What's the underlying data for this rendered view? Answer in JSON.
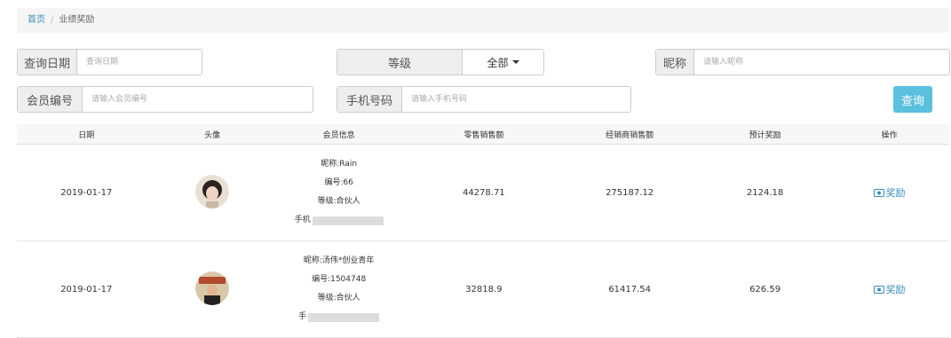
{
  "breadcrumb": {
    "home": "首页",
    "separator": "/",
    "current": "业绩奖励"
  },
  "filters": {
    "date_label": "查询日期",
    "date_placeholder": "查询日期",
    "level_label": "等级",
    "level_value": "全部",
    "nickname_label": "昵称",
    "nickname_placeholder": "请输入昵称",
    "member_label": "会员编号",
    "member_placeholder": "请输入会员编号",
    "phone_label": "手机号码",
    "phone_placeholder": "请输入手机号码",
    "query_button": "查询"
  },
  "table": {
    "headers": [
      "日期",
      "头像",
      "会员信息",
      "零售销售额",
      "经销商销售额",
      "预计奖励",
      "操作"
    ],
    "rows": [
      {
        "date": "2019-01-17",
        "nickname": "昵称:Rain",
        "number": "编号:66",
        "level": "等级:合伙人",
        "phone": "手机",
        "retail": "44278.71",
        "dealer": "275187.12",
        "reward": "2124.18",
        "action": "奖励"
      },
      {
        "date": "2019-01-17",
        "nickname": "昵称:汤伟*创业青年",
        "number": "编号:1504748",
        "level": "等级:合伙人",
        "phone": "手",
        "retail": "32818.9",
        "dealer": "61417.54",
        "reward": "626.59",
        "action": "奖励"
      }
    ]
  },
  "icons": {
    "dropdown": "caret-down-icon",
    "reward": "money-icon"
  },
  "colors": {
    "accent": "#3c8dbc",
    "query_button": "#5bc0de"
  }
}
